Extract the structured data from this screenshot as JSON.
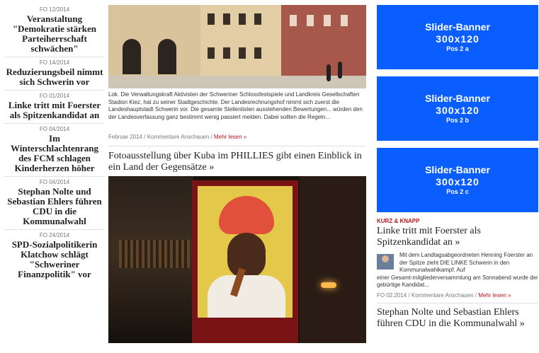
{
  "left_news": [
    {
      "date_before": "FO 12/2014",
      "title": "Veranstaltung \"Demokratie stärken Parteiherrschaft schwächen\""
    },
    {
      "date_before": "FO 14/2014",
      "title": "Reduzierungsbeil nimmt sich Schwerin vor"
    },
    {
      "date_before": "FO 01/2014",
      "title": "Linke tritt mit Foerster als Spitzenkandidat an"
    },
    {
      "date_before": "FO 04/2014",
      "title": "Im Winterschlachtenrang des FCM schlagen Kinderherzen höher"
    },
    {
      "date_before": "FO 04/2014",
      "title": "Stephan Nolte und Sebastian Ehlers führen CDU in die Kommunalwahl"
    },
    {
      "date_before": "FO 24/2014",
      "title": "SPD-Sozialpolitikerin Klatchow schlägt \"Schweriner Finanzpolitik\" vor"
    }
  ],
  "middle": {
    "caption": "Lok. Die Verwaltungskraft Aktivisten der Schweriner Schlossfestspiele und Landkreis Gesellschaften Stadion Kiez, hat zu seiner Stadtgeschichte. Der Landesrechnungshof nimmt sich zuerst die Landeshauptstadt Schwerin vor. Die gesamte Stellenlisten ausstehenden Bewertungen... würden den der Landesverfassung ganz bestimmt wenig passiert melden. Dabei sollten die Regeln...",
    "meta_text": "Februar 2014 / Kommentare Anschauen / ",
    "meta_more": "Mehr lesen »",
    "headline": "Fotoausstellung über Kuba im PHILLIES gibt einen Einblick in ein Land der Gegensätze »"
  },
  "banners": [
    {
      "line1": "Slider-Banner",
      "line2": "300x120",
      "line3": "Pos 2 a"
    },
    {
      "line1": "Slider-Banner",
      "line2": "300x120",
      "line3": "Pos 2 b"
    },
    {
      "line1": "Slider-Banner",
      "line2": "300x120",
      "line3": "Pos 2 c"
    }
  ],
  "right": {
    "kicker": "KURZ & KNAPP",
    "headline": "Linke tritt mit Foerster als Spitzenkandidat an »",
    "teaser": "Mit dem Landtagsabgeordneten Henning Foerster an der Spitze zieht DIE LINKE Schwerin in den Kommunalwahlkampf. Auf",
    "teaser2": "einer Gesamt-mitgliederversammlung am Sonnabend wurde der gebürtige Kandidat...",
    "meta_text": "FO 02.2014 / Kommentare Anschauen / ",
    "meta_more": "Mehr lesen »",
    "headline2": "Stephan Nolte und Sebastian Ehlers führen CDU in die Kommunalwahl »"
  }
}
